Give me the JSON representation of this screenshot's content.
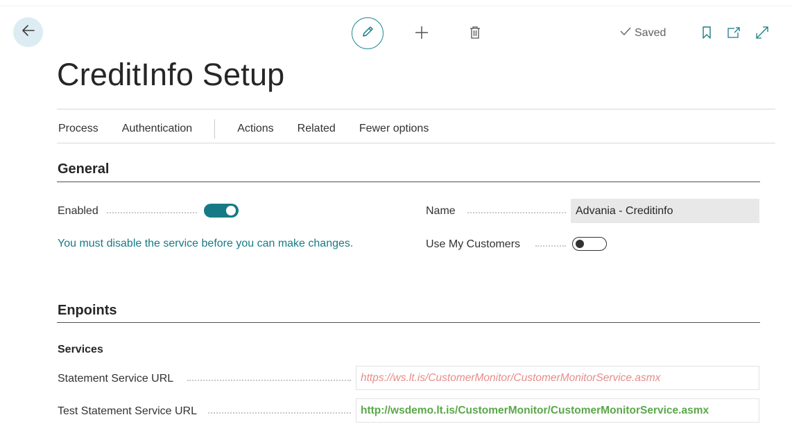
{
  "header": {
    "back_icon": "arrow-left-icon",
    "edit_icon": "pencil-icon",
    "new_icon": "plus-icon",
    "delete_icon": "trash-icon",
    "saved_label": "Saved",
    "bookmark_icon": "bookmark-icon",
    "open_new_window_icon": "open-in-new-window-icon",
    "expand_icon": "expand-icon"
  },
  "page": {
    "title": "CreditInfo Setup"
  },
  "actionbar": {
    "items": [
      "Process",
      "Authentication",
      "Actions",
      "Related",
      "Fewer options"
    ]
  },
  "general": {
    "title": "General",
    "enabled_label": "Enabled",
    "enabled_value": true,
    "info_message": "You must disable the service before you can make changes.",
    "name_label": "Name",
    "name_value": "Advania - Creditinfo",
    "use_my_customers_label": "Use My Customers",
    "use_my_customers_value": false
  },
  "endpoints": {
    "title": "Enpoints",
    "group_title": "Services",
    "statement_url_label": "Statement Service URL",
    "statement_url_value": "https://ws.lt.is/CustomerMonitor/CustomerMonitorService.asmx",
    "test_statement_url_label": "Test Statement Service URL",
    "test_statement_url_value": "http://wsdemo.lt.is/CustomerMonitor/CustomerMonitorService.asmx"
  },
  "colors": {
    "accent": "#167a86",
    "error_text": "#e88b8b",
    "success_text": "#5aa74a",
    "back_button_bg": "#dcecf2"
  }
}
